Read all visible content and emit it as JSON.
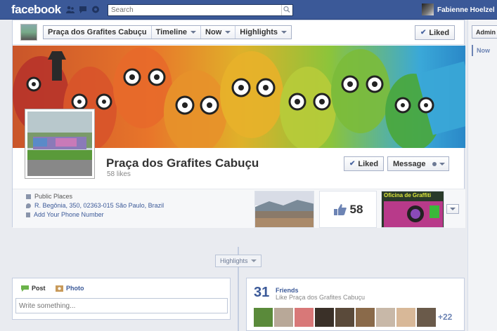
{
  "topbar": {
    "logo": "facebook",
    "search_placeholder": "Search",
    "user_name": "Fabienne Hoelzel",
    "icons": [
      "friend-requests-icon",
      "messages-icon",
      "notifications-icon",
      "search-icon"
    ]
  },
  "pagebar": {
    "crumbs": [
      "Praça dos Grafites Cabuçu",
      "Timeline",
      "Now",
      "Highlights"
    ],
    "liked_label": "Liked"
  },
  "page": {
    "name": "Praça dos Grafites Cabuçu",
    "likes": "58 likes",
    "liked_button": "Liked",
    "message_button": "Message"
  },
  "info": {
    "category": "Public Places",
    "address": "R. Begônia, 350, 02363-015 São Paulo, Brazil",
    "phone": "Add Your Phone Number"
  },
  "tiles": {
    "likes_count": "58",
    "app_title": "Oficina de Graffiti"
  },
  "timeline": {
    "highlights_label": "Highlights",
    "composer_tabs": [
      "Post",
      "Photo"
    ],
    "composer_placeholder": "Write something..."
  },
  "friends": {
    "count": "31",
    "title": "Friends",
    "subtitle": "Like Praça dos Grafites Cabuçu",
    "more": "+22"
  },
  "rail": {
    "admin_label": "Admin",
    "now_label": "Now"
  },
  "colors": {
    "brand": "#3b5998",
    "accent_link": "#3b5998",
    "background": "#e9ebf0"
  }
}
